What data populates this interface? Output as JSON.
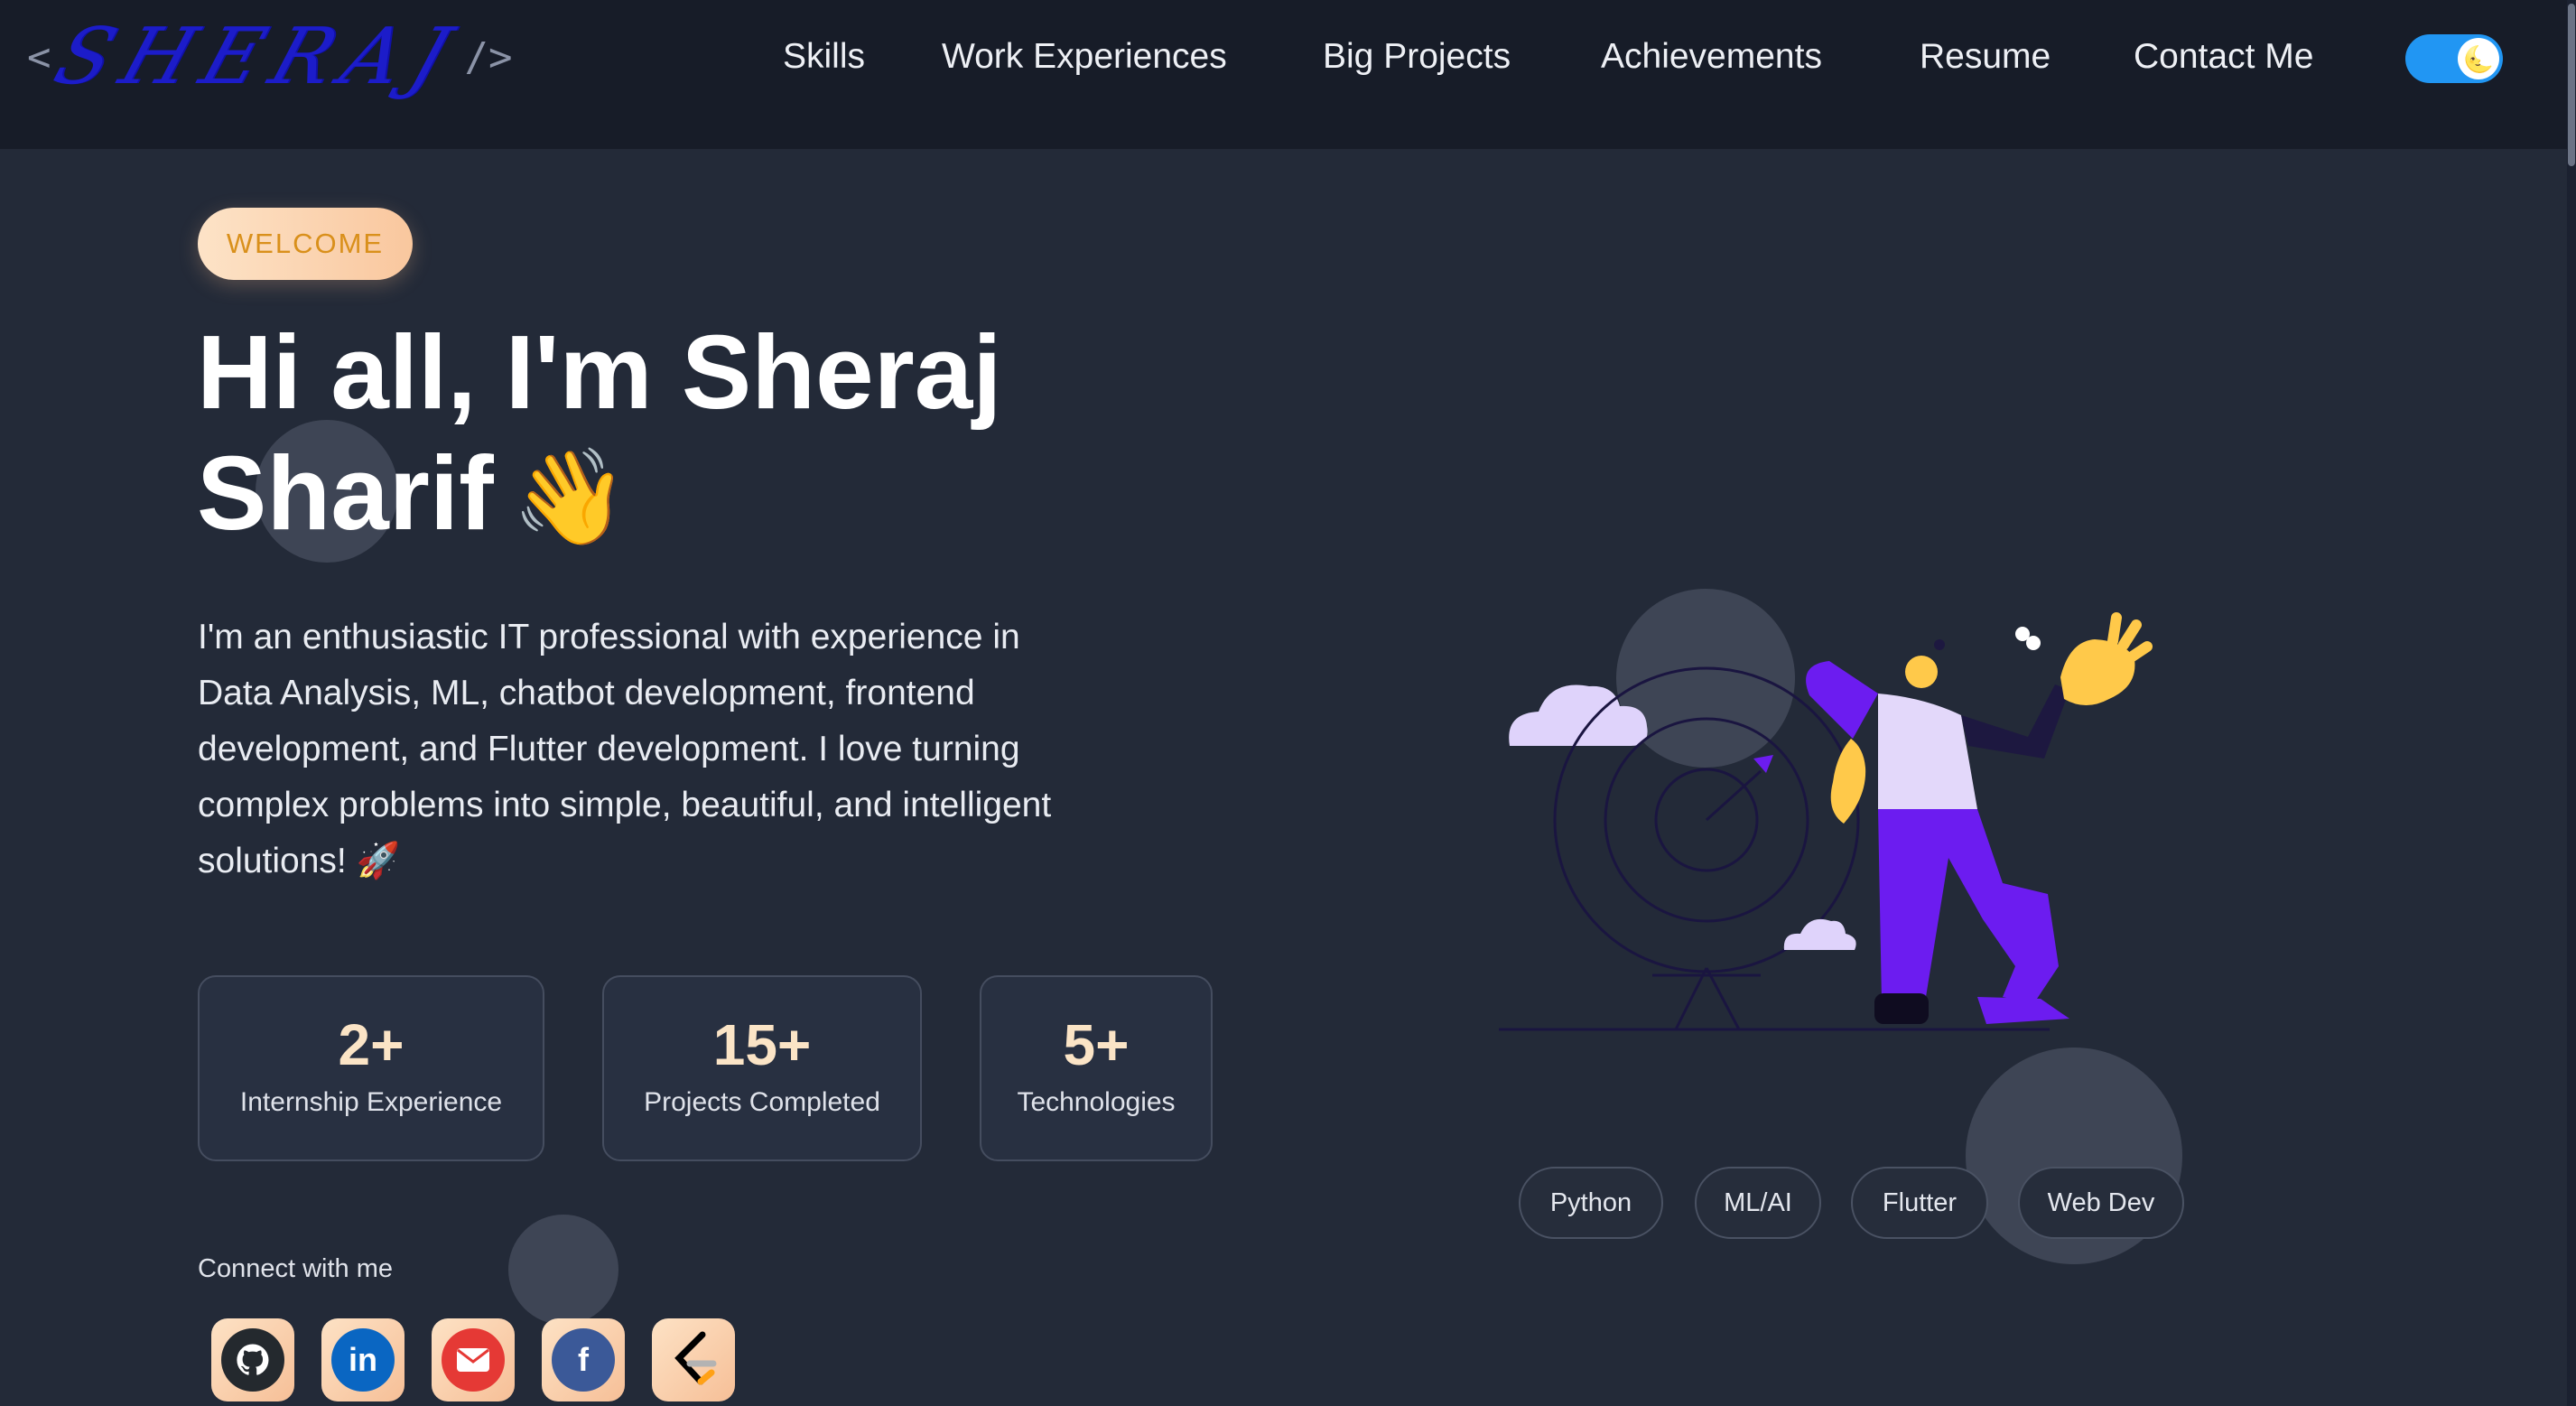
{
  "logo": {
    "open": "<",
    "name": "SHERAJ",
    "close": "/>"
  },
  "nav": [
    {
      "label": "Skills"
    },
    {
      "label": "Work Experiences"
    },
    {
      "label": "Big Projects"
    },
    {
      "label": "Achievements"
    },
    {
      "label": "Resume"
    },
    {
      "label": "Contact Me"
    }
  ],
  "theme_toggle": {
    "icon": "moon-emoji",
    "glyph": "🌜",
    "state": "dark"
  },
  "hero": {
    "badge": "WELCOME",
    "title_line1": "Hi all, I'm Sheraj",
    "title_line2": "Sharif",
    "wave_emoji": "👋",
    "description": "I'm an enthusiastic IT professional with experience in Data Analysis, ML, chatbot development, frontend development, and Flutter development. I love turning complex problems into simple, beautiful, and intelligent solutions! 🚀"
  },
  "stats": [
    {
      "value": "2+",
      "label": "Internship Experience"
    },
    {
      "value": "15+",
      "label": "Projects Completed"
    },
    {
      "value": "5+",
      "label": "Technologies"
    }
  ],
  "connect": {
    "label": "Connect with me",
    "socials": [
      {
        "icon": "github-icon",
        "color": "#24292e",
        "glyph": "⬤"
      },
      {
        "icon": "linkedin-icon",
        "color": "#0a66c2",
        "glyph": "in"
      },
      {
        "icon": "mail-icon",
        "color": "#e53935",
        "glyph": "✉"
      },
      {
        "icon": "facebook-icon",
        "color": "#3b5998",
        "glyph": "f"
      },
      {
        "icon": "leetcode-icon",
        "color": "#ffa116",
        "glyph": ""
      }
    ]
  },
  "tags": [
    {
      "label": "Python"
    },
    {
      "label": "ML/AI"
    },
    {
      "label": "Flutter"
    },
    {
      "label": "Web Dev"
    }
  ],
  "colors": {
    "background": "#232a38",
    "navbar": "#171c28",
    "accent_purple": "#6c1cf0",
    "badge_text": "#d9901b",
    "stat_value": "#fbe4c6",
    "toggle": "#2196f3"
  }
}
